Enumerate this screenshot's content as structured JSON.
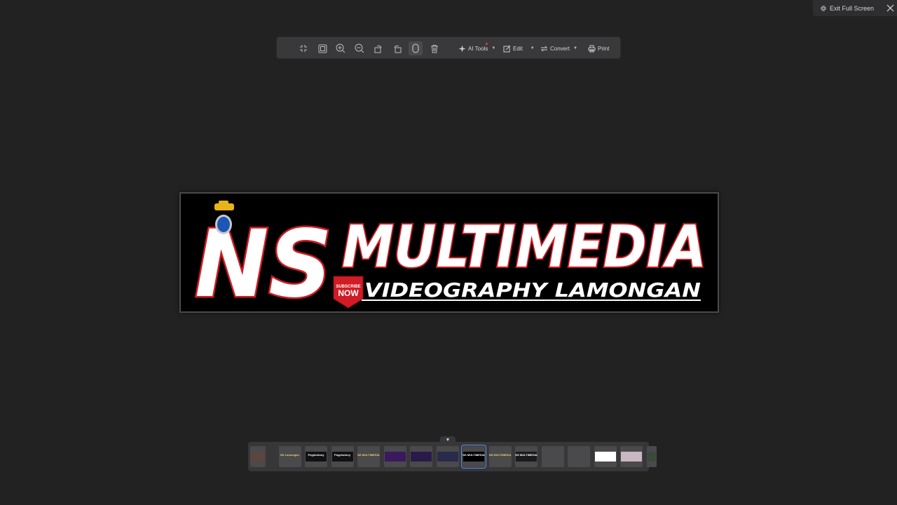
{
  "topbar": {
    "exit_full_screen_label": "Exit Full Screen"
  },
  "toolbar": {
    "icons": [
      "exit-fit-icon",
      "fit-page-icon",
      "zoom-in-icon",
      "zoom-out-icon",
      "rotate-left-icon",
      "rotate-right-icon",
      "pan-hand-icon",
      "delete-icon"
    ],
    "active_icon": "pan-hand-icon",
    "ai_tools_label": "AI Tools",
    "edit_label": "Edit",
    "convert_label": "Convert",
    "print_label": "Print"
  },
  "banner": {
    "logo_text": "NS",
    "title": "MULTIMEDIA",
    "subtitle": "VIDEOGRAPHY LAMONGAN",
    "badge_top": "SUBSCRIBE",
    "badge_bottom": "NOW"
  },
  "filmstrip": {
    "selected_index": 8,
    "thumbnails": [
      {
        "text": "",
        "bg": "#5a4540"
      },
      {
        "text": "NS Lamongan",
        "bg": "#4a4a4d"
      },
      {
        "text": "Payphotony",
        "bg": "#111111"
      },
      {
        "text": "Payphotony",
        "bg": "#111111"
      },
      {
        "text": "NS MULTIMEDIA",
        "bg": "#4a4a4d"
      },
      {
        "text": "",
        "bg": "#3a1a5a"
      },
      {
        "text": "",
        "bg": "#2a1a4a"
      },
      {
        "text": "",
        "bg": "#2a2a4a"
      },
      {
        "text": "NS MULTIMEDIA",
        "bg": "#000000"
      },
      {
        "text": "NS MULTIMEDIA",
        "bg": "#4a4a4d"
      },
      {
        "text": "NS MULTIMEDIA",
        "bg": "#1a1a1a"
      },
      {
        "text": "",
        "bg": "#4a4a4d"
      },
      {
        "text": "",
        "bg": "#4a4a4d"
      },
      {
        "text": "",
        "bg": "#ffffff"
      },
      {
        "text": "",
        "bg": "#c8b6c0"
      },
      {
        "text": "",
        "bg": "#3a4a3a"
      }
    ]
  }
}
